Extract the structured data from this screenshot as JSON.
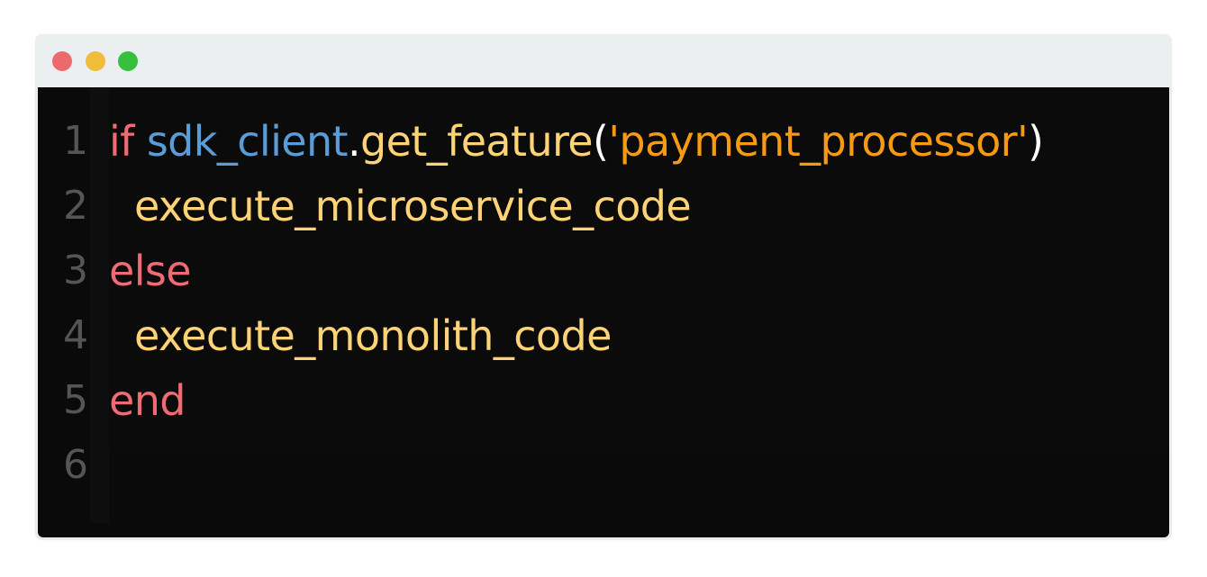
{
  "window": {
    "controls": {
      "close_color": "#ec6a6e",
      "minimize_color": "#f0bd3a",
      "maximize_color": "#37c03e"
    }
  },
  "colors": {
    "keyword": "#ef6b73",
    "object": "#5b9bd6",
    "method": "#fcd477",
    "string": "#f59a12",
    "punct": "#ffffff",
    "plain": "#fcd477",
    "line_number": "#555555"
  },
  "editor": {
    "lines": [
      {
        "number": "1",
        "tokens": [
          {
            "text": "if",
            "kind": "keyword"
          },
          {
            "text": " ",
            "kind": "plain"
          },
          {
            "text": "sdk_client",
            "kind": "object"
          },
          {
            "text": ".",
            "kind": "punct"
          },
          {
            "text": "get_feature",
            "kind": "method"
          },
          {
            "text": "(",
            "kind": "punct"
          },
          {
            "text": "'payment_processor'",
            "kind": "string"
          },
          {
            "text": ")",
            "kind": "punct"
          }
        ]
      },
      {
        "number": "2",
        "tokens": [
          {
            "text": "  execute_microservice_code",
            "kind": "method"
          }
        ]
      },
      {
        "number": "3",
        "tokens": [
          {
            "text": "else",
            "kind": "keyword"
          }
        ]
      },
      {
        "number": "4",
        "tokens": [
          {
            "text": "  execute_monolith_code",
            "kind": "method"
          }
        ]
      },
      {
        "number": "5",
        "tokens": [
          {
            "text": "end",
            "kind": "keyword"
          }
        ]
      },
      {
        "number": "6",
        "tokens": []
      }
    ]
  }
}
